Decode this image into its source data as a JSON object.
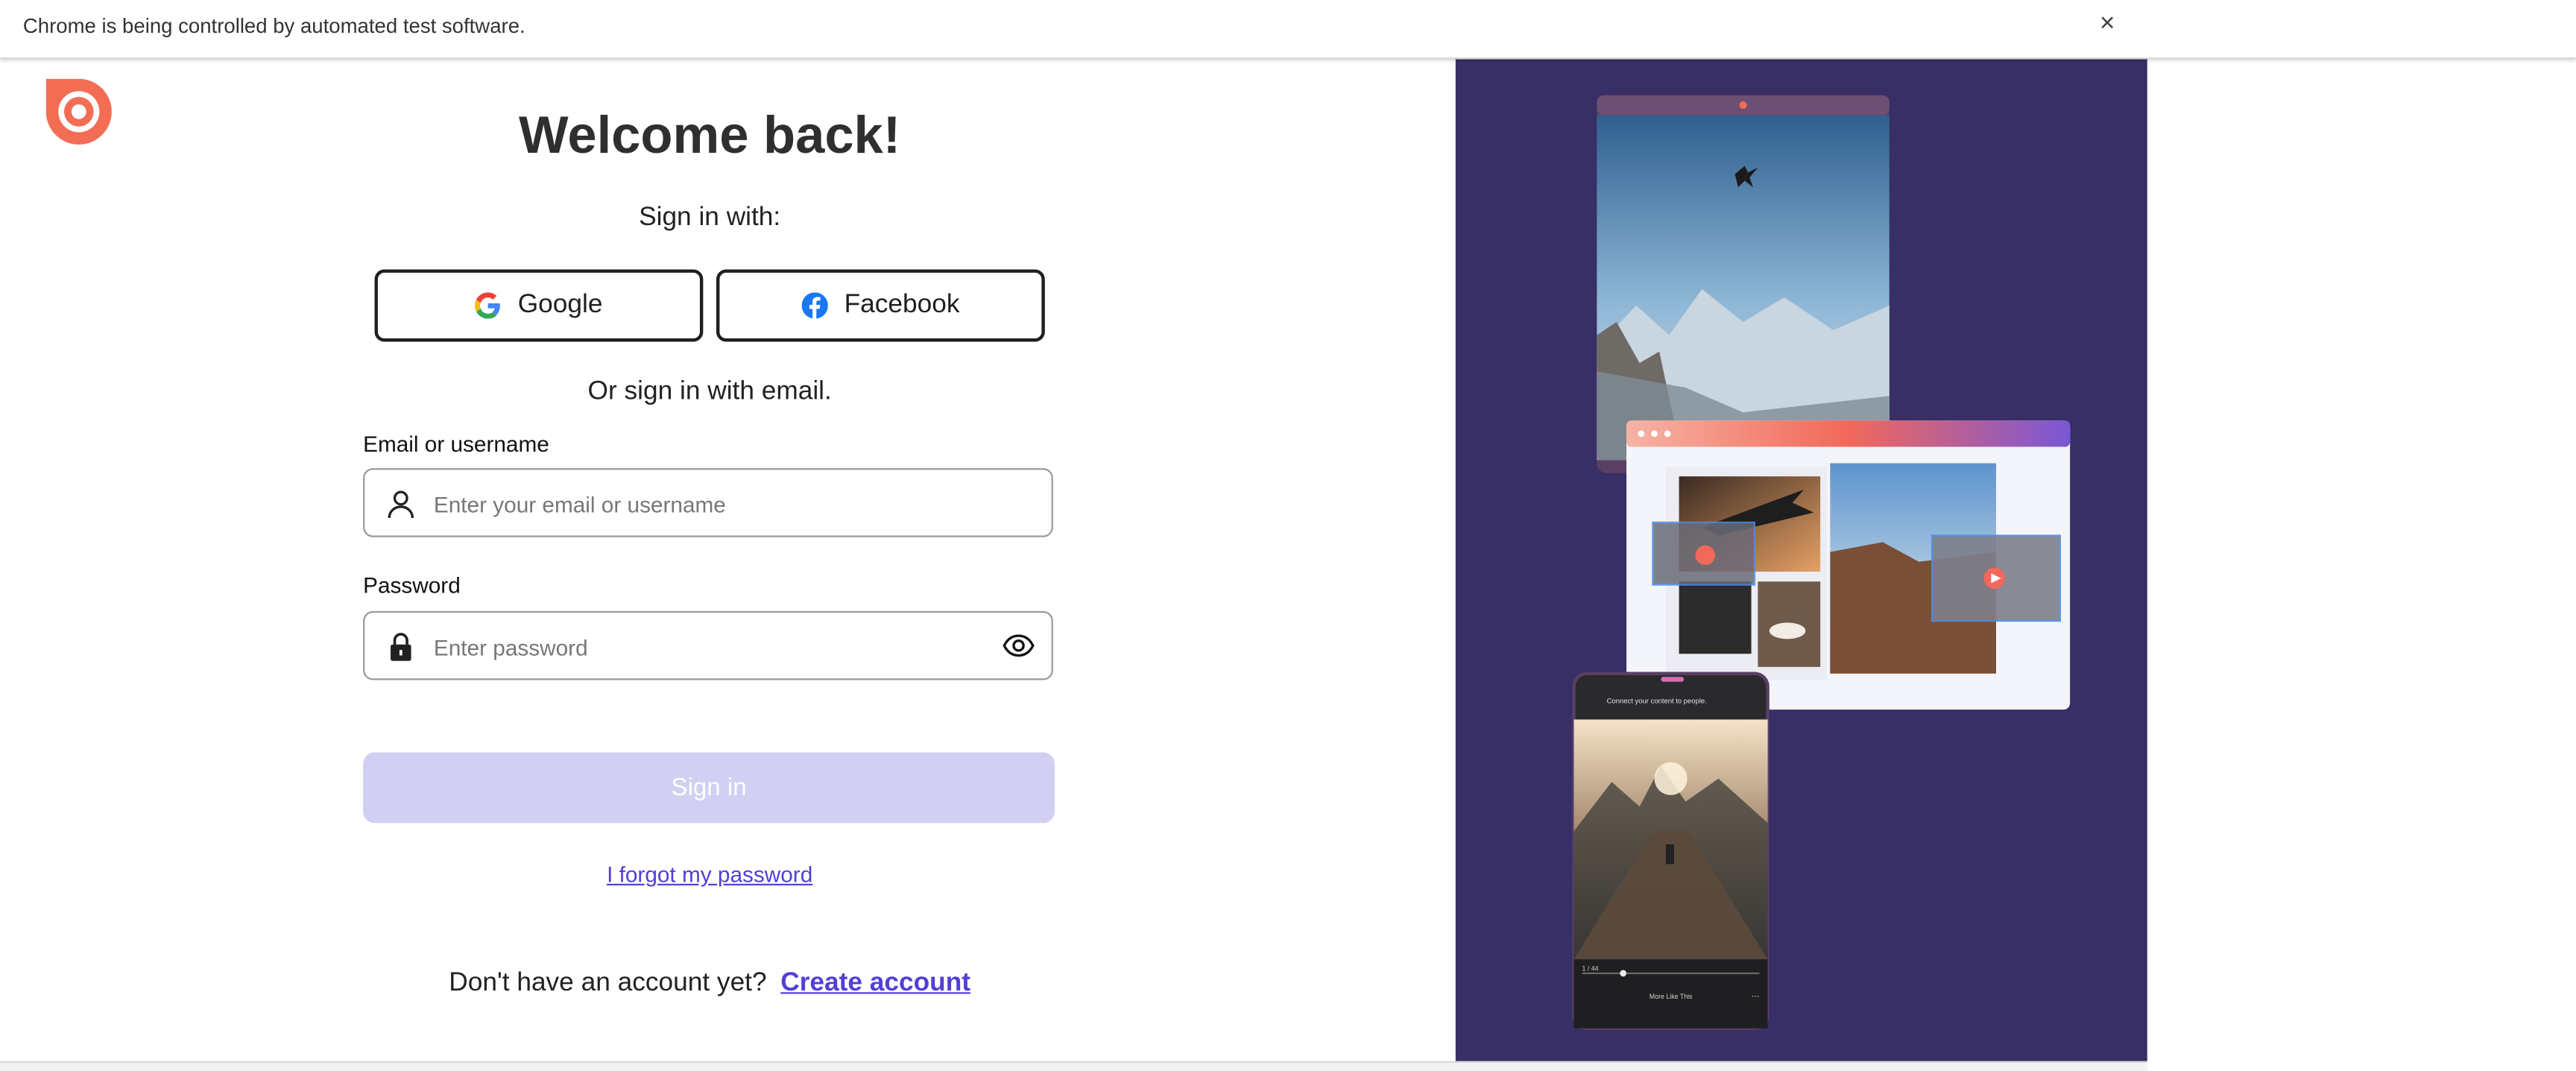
{
  "infobar": {
    "message": "Chrome is being controlled by automated test software.",
    "close_symbol": "×"
  },
  "brand": {
    "logo_icon": "issuu-logo-icon",
    "logo_color": "#f36d55"
  },
  "login": {
    "title": "Welcome back!",
    "social_prompt": "Sign in with:",
    "google_label": "Google",
    "facebook_label": "Facebook",
    "email_prompt": "Or sign in with email.",
    "email_label": "Email or username",
    "email_placeholder": "Enter your email or username",
    "email_value": "",
    "password_label": "Password",
    "password_placeholder": "Enter password",
    "password_value": "",
    "signin_label": "Sign in",
    "forgot_label": "I forgot my password",
    "no_account_text": "Don't have an account yet?",
    "create_account_label": "Create account"
  },
  "promo": {
    "background_color": "#372f66",
    "phone_caption": "Connect your content to people.",
    "phone_counter": "1 / 44",
    "phone_more_label": "More Like This"
  },
  "colors": {
    "accent": "#5140d6",
    "signin_disabled": "#d1d0f3"
  }
}
